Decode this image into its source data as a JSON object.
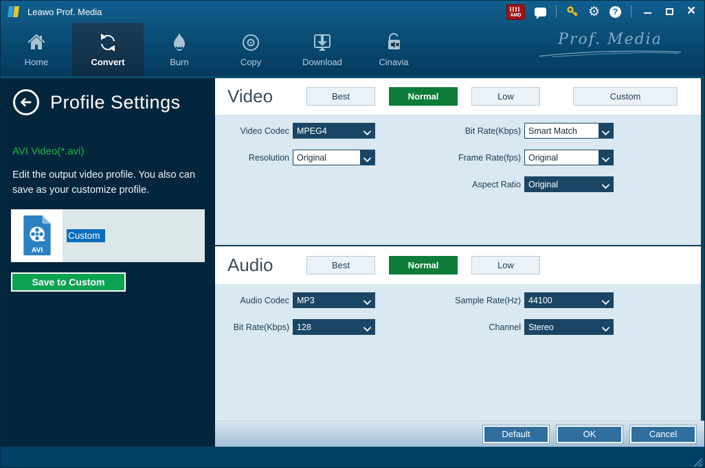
{
  "window": {
    "title": "Leawo Prof. Media",
    "brand": "Prof. Media"
  },
  "titlebar": {
    "amd_label": "AMD",
    "help_glyph": "?",
    "gear_glyph": "⚙",
    "close_glyph": "×"
  },
  "nav": {
    "tabs": [
      {
        "label": "Home"
      },
      {
        "label": "Convert"
      },
      {
        "label": "Burn"
      },
      {
        "label": "Copy"
      },
      {
        "label": "Download"
      },
      {
        "label": "Cinavia"
      }
    ]
  },
  "sidebar": {
    "title": "Profile Settings",
    "profile_name": "AVI Video(*.avi)",
    "description": "Edit the output video profile. You also can save as your customize profile.",
    "custom_item": {
      "badge": "AVI",
      "name": "Custom"
    },
    "save_button": "Save to Custom"
  },
  "video": {
    "title": "Video",
    "quality": [
      {
        "label": "Best",
        "active": false
      },
      {
        "label": "Normal",
        "active": true
      },
      {
        "label": "Low",
        "active": false
      },
      {
        "label": "Custom",
        "active": false
      }
    ],
    "fields": [
      {
        "label": "Video Codec",
        "value": "MPEG4"
      },
      {
        "label": "Resolution",
        "value": "Original"
      },
      {
        "label": "Bit Rate(Kbps)",
        "value": "Smart Match"
      },
      {
        "label": "Frame Rate(fps)",
        "value": "Original"
      },
      {
        "label": "Aspect Ratio",
        "value": "Original"
      }
    ]
  },
  "audio": {
    "title": "Audio",
    "quality": [
      {
        "label": "Best",
        "active": false
      },
      {
        "label": "Normal",
        "active": true
      },
      {
        "label": "Low",
        "active": false
      }
    ],
    "fields": [
      {
        "label": "Audio Codec",
        "value": "MP3"
      },
      {
        "label": "Bit Rate(Kbps)",
        "value": "128"
      },
      {
        "label": "Sample Rate(Hz)",
        "value": "44100"
      },
      {
        "label": "Channel",
        "value": "Stereo"
      }
    ]
  },
  "footer": {
    "buttons": [
      {
        "label": "Default"
      },
      {
        "label": "OK"
      },
      {
        "label": "Cancel"
      }
    ]
  },
  "colors": {
    "accent_green_active": "#0d7c38",
    "save_green": "#0ba351",
    "selection_blue": "#0a6ebd",
    "dropdown_navy": "#1b4564",
    "sidebar_navy": "#04263c",
    "footer_blue": "#004165",
    "profile_green_text": "#23b14b"
  }
}
